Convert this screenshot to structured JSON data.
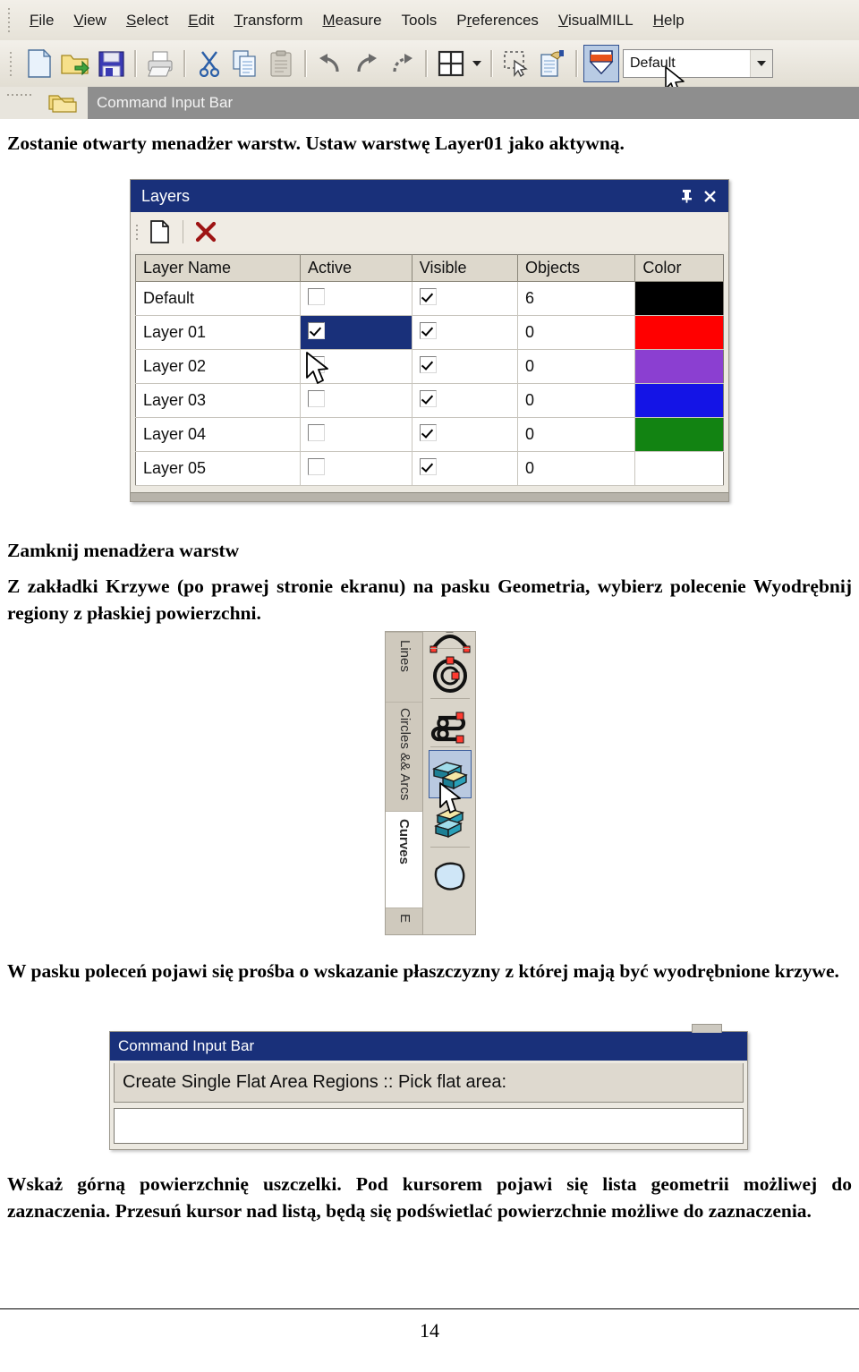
{
  "app": {
    "menu": [
      {
        "pre": "",
        "accel": "F",
        "post": "ile"
      },
      {
        "pre": "",
        "accel": "V",
        "post": "iew"
      },
      {
        "pre": "",
        "accel": "S",
        "post": "elect"
      },
      {
        "pre": "",
        "accel": "E",
        "post": "dit"
      },
      {
        "pre": "",
        "accel": "T",
        "post": "ransform"
      },
      {
        "pre": "",
        "accel": "M",
        "post": "easure"
      },
      {
        "pre": "Tools",
        "accel": "",
        "post": ""
      },
      {
        "pre": "P",
        "accel": "r",
        "post": "eferences"
      },
      {
        "pre": "",
        "accel": "V",
        "post": "isualMILL"
      },
      {
        "pre": "",
        "accel": "H",
        "post": "elp"
      }
    ],
    "toolbar": {
      "icons": [
        "new-file-icon",
        "open-folder-icon",
        "save-floppy-icon",
        "print-icon",
        "cut-scissors-icon",
        "copy-icon",
        "paste-clipboard-icon",
        "undo-icon",
        "redo-icon",
        "redo-all-icon",
        "viewports-grid-icon",
        "viewports-dropdown-arrow-icon",
        "select-rectangle-icon",
        "properties-icon",
        "layers-manager-icon"
      ],
      "layer_combo_value": "Default"
    },
    "command_strip_title": "Command Input Bar"
  },
  "text": {
    "intro": "Zostanie otwarty menadżer warstw. Ustaw warstwę Layer01 jako aktywną.",
    "close_manager": "Zamknij menadżera warstw",
    "curves_instruction": "Z zakładki Krzywe (po prawej stronie ekranu) na pasku Geometria, wybierz polecenie Wyodrębnij regiony z płaskiej powierzchni.",
    "command_prompt_note": "W pasku poleceń pojawi się prośba o wskazanie płaszczyzny z której mają być wyodrębnione krzywe.",
    "pick_surface_note": "Wskaż górną powierzchnię uszczelki. Pod kursorem pojawi się lista geometrii możliwej do zaznaczenia. Przesuń kursor nad listą, będą się podświetlać powierzchnie możliwe do zaznaczenia."
  },
  "layers_dialog": {
    "title": "Layers",
    "pin_icon": "pin-icon",
    "close_icon": "close-icon",
    "toolbar": {
      "new_layer_icon": "new-layer-page-icon",
      "delete_layer_icon": "delete-layer-x-icon"
    },
    "columns": [
      "Layer Name",
      "Active",
      "Visible",
      "Objects",
      "Color"
    ],
    "rows": [
      {
        "name": "Default",
        "active": false,
        "active_selected": false,
        "visible": true,
        "objects": "6",
        "color": "#000000"
      },
      {
        "name": "Layer 01",
        "active": true,
        "active_selected": true,
        "visible": true,
        "objects": "0",
        "color": "#ff0000"
      },
      {
        "name": "Layer 02",
        "active": false,
        "active_selected": false,
        "visible": true,
        "objects": "0",
        "color": "#8b3fd1"
      },
      {
        "name": "Layer 03",
        "active": false,
        "active_selected": false,
        "visible": true,
        "objects": "0",
        "color": "#1414e6"
      },
      {
        "name": "Layer 04",
        "active": false,
        "active_selected": false,
        "visible": true,
        "objects": "0",
        "color": "#128312"
      },
      {
        "name": "Layer 05",
        "active": false,
        "active_selected": false,
        "visible": true,
        "objects": "0",
        "color": "#ffffff"
      }
    ]
  },
  "curves_toolbar": {
    "tabs": [
      {
        "label": "Lines",
        "selected": false
      },
      {
        "label": "Circles && Arcs",
        "selected": false
      },
      {
        "label": "Curves",
        "selected": true
      },
      {
        "label": "E",
        "selected": false
      }
    ],
    "buttons": [
      {
        "icon": "arc-3-point-icon",
        "selected": false
      },
      {
        "icon": "circle-through-points-icon",
        "selected": false
      },
      {
        "icon": "spiral-curve-icon",
        "selected": false
      },
      {
        "icon": "flat-area-regions-icon",
        "selected": true
      },
      {
        "icon": "flat-area-regions-single-icon",
        "selected": false
      },
      {
        "icon": "surface-boundary-curve-icon",
        "selected": false
      }
    ]
  },
  "command_input_bar": {
    "title": "Command Input Bar",
    "message": "Create Single Flat Area Regions :: Pick flat area:",
    "input_value": ""
  },
  "footer": {
    "page_number": "14"
  }
}
